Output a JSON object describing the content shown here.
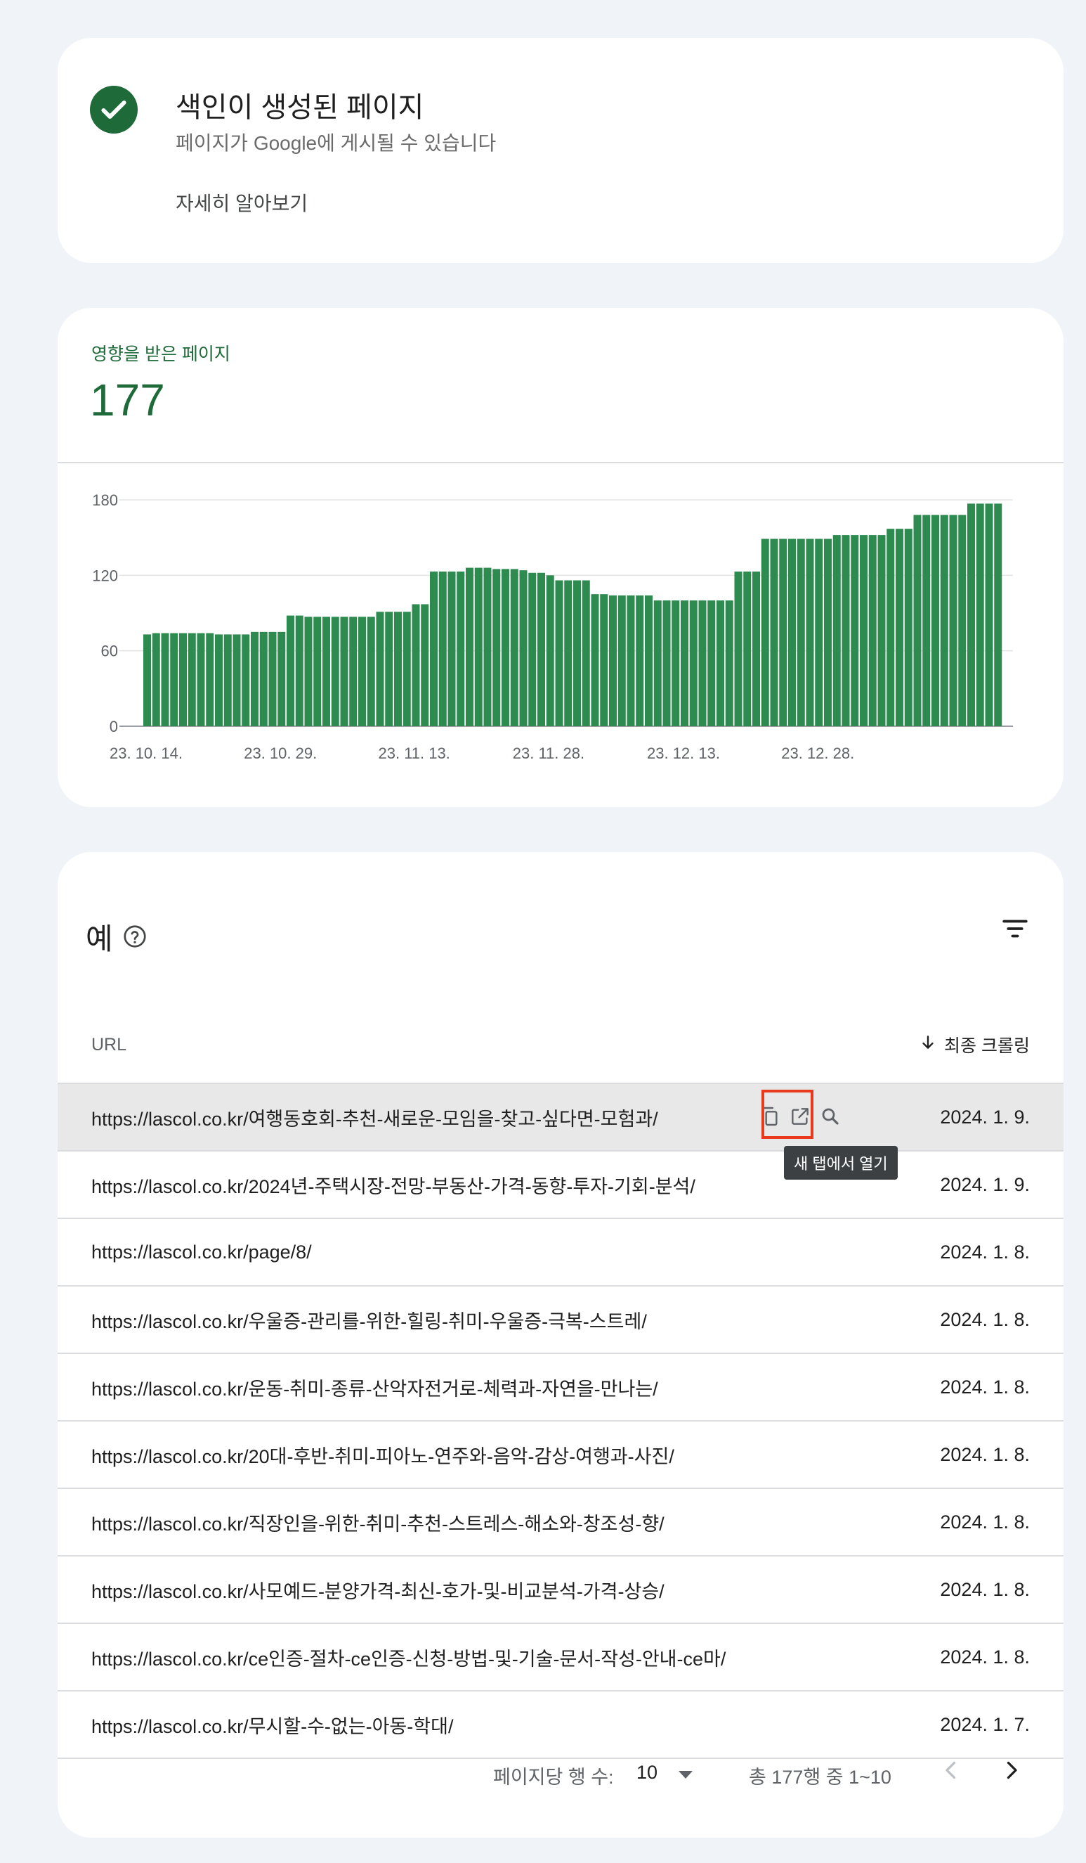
{
  "status": {
    "title": "색인이 생성된 페이지",
    "subtitle": "페이지가 Google에 게시될 수 있습니다",
    "learn_more": "자세히 알아보기",
    "icon": "check-circle-icon",
    "color": "#1e6a39"
  },
  "metric": {
    "label": "영향을 받은 페이지",
    "value": "177",
    "color": "#1e6a39"
  },
  "chart_data": {
    "type": "bar",
    "color": "#2e8b4f",
    "ylim": [
      0,
      180
    ],
    "yticks": [
      0,
      60,
      120,
      180
    ],
    "grid": true,
    "xtick_labels": [
      "23. 10. 14.",
      "23. 10. 29.",
      "23. 11. 13.",
      "23. 11. 28.",
      "23. 12. 13.",
      "23. 12. 28."
    ],
    "xtick_index": [
      0,
      15,
      30,
      45,
      60,
      75
    ],
    "values": [
      73,
      74,
      74,
      74,
      74,
      74,
      74,
      74,
      73,
      73,
      73,
      73,
      75,
      75,
      75,
      75,
      88,
      88,
      87,
      87,
      87,
      87,
      87,
      87,
      87,
      87,
      91,
      91,
      91,
      91,
      97,
      97,
      123,
      123,
      123,
      123,
      126,
      126,
      126,
      125,
      125,
      125,
      124,
      122,
      122,
      120,
      116,
      116,
      116,
      116,
      105,
      105,
      104,
      104,
      104,
      104,
      104,
      100,
      100,
      100,
      100,
      100,
      100,
      100,
      100,
      100,
      123,
      123,
      123,
      149,
      149,
      149,
      149,
      149,
      149,
      149,
      149,
      152,
      152,
      152,
      152,
      152,
      152,
      157,
      157,
      157,
      168,
      168,
      168,
      168,
      168,
      168,
      177,
      177,
      177,
      177
    ]
  },
  "examples": {
    "title": "예",
    "help_icon": "help-circle-icon",
    "filter_icon": "filter-icon",
    "col_url": "URL",
    "col_crawl": "최종 크롤링",
    "sort_icon": "arrow-down-icon",
    "tooltip": "새 탭에서 열기",
    "rows": [
      {
        "url": "https://lascol.co.kr/여행동호회-추천-새로운-모임을-찾고-싶다면-모험과/",
        "date": "2024. 1. 9."
      },
      {
        "url": "https://lascol.co.kr/2024년-주택시장-전망-부동산-가격-동향-투자-기회-분석/",
        "date": "2024. 1. 9."
      },
      {
        "url": "https://lascol.co.kr/page/8/",
        "date": "2024. 1. 8."
      },
      {
        "url": "https://lascol.co.kr/우울증-관리를-위한-힐링-취미-우울증-극복-스트레/",
        "date": "2024. 1. 8."
      },
      {
        "url": "https://lascol.co.kr/운동-취미-종류-산악자전거로-체력과-자연을-만나는/",
        "date": "2024. 1. 8."
      },
      {
        "url": "https://lascol.co.kr/20대-후반-취미-피아노-연주와-음악-감상-여행과-사진/",
        "date": "2024. 1. 8."
      },
      {
        "url": "https://lascol.co.kr/직장인을-위한-취미-추천-스트레스-해소와-창조성-향/",
        "date": "2024. 1. 8."
      },
      {
        "url": "https://lascol.co.kr/사모예드-분양가격-최신-호가-및-비교분석-가격-상승/",
        "date": "2024. 1. 8."
      },
      {
        "url": "https://lascol.co.kr/ce인증-절차-ce인증-신청-방법-및-기술-문서-작성-안내-ce마/",
        "date": "2024. 1. 8."
      },
      {
        "url": "https://lascol.co.kr/무시할-수-없는-아동-학대/",
        "date": "2024. 1. 7."
      }
    ]
  },
  "pager": {
    "rows_per_page_label": "페이지당 행 수:",
    "rows_per_page": "10",
    "range": "총 177행 중 1~10"
  }
}
